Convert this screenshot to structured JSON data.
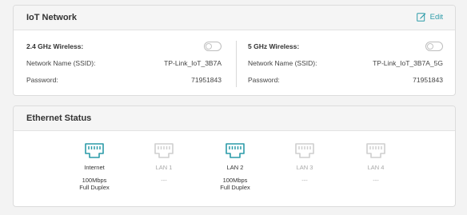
{
  "iot": {
    "title": "IoT Network",
    "edit_label": "Edit",
    "wireless_24": {
      "label": "2.4 GHz Wireless:",
      "enabled": false,
      "ssid_label": "Network Name (SSID):",
      "ssid": "TP-Link_IoT_3B7A",
      "password_label": "Password:",
      "password": "71951843"
    },
    "wireless_5": {
      "label": "5 GHz Wireless:",
      "enabled": false,
      "ssid_label": "Network Name (SSID):",
      "ssid": "TP-Link_IoT_3B7A_5G",
      "password_label": "Password:",
      "password": "71951843"
    }
  },
  "ethernet": {
    "title": "Ethernet Status",
    "ports": [
      {
        "name": "Internet",
        "status_line1": "100Mbps",
        "status_line2": "Full Duplex",
        "connected": true
      },
      {
        "name": "LAN 1",
        "status_line1": "---",
        "status_line2": "",
        "connected": false
      },
      {
        "name": "LAN 2",
        "status_line1": "100Mbps",
        "status_line2": "Full Duplex",
        "connected": true
      },
      {
        "name": "LAN 3",
        "status_line1": "---",
        "status_line2": "",
        "connected": false
      },
      {
        "name": "LAN 4",
        "status_line1": "---",
        "status_line2": "",
        "connected": false
      }
    ]
  },
  "colors": {
    "accent": "#2c9ba8",
    "port_active": "#2c9ba8",
    "port_inactive": "#cfcfcf"
  },
  "icons": {
    "edit": "edit-icon",
    "port": "ethernet-port-icon"
  }
}
